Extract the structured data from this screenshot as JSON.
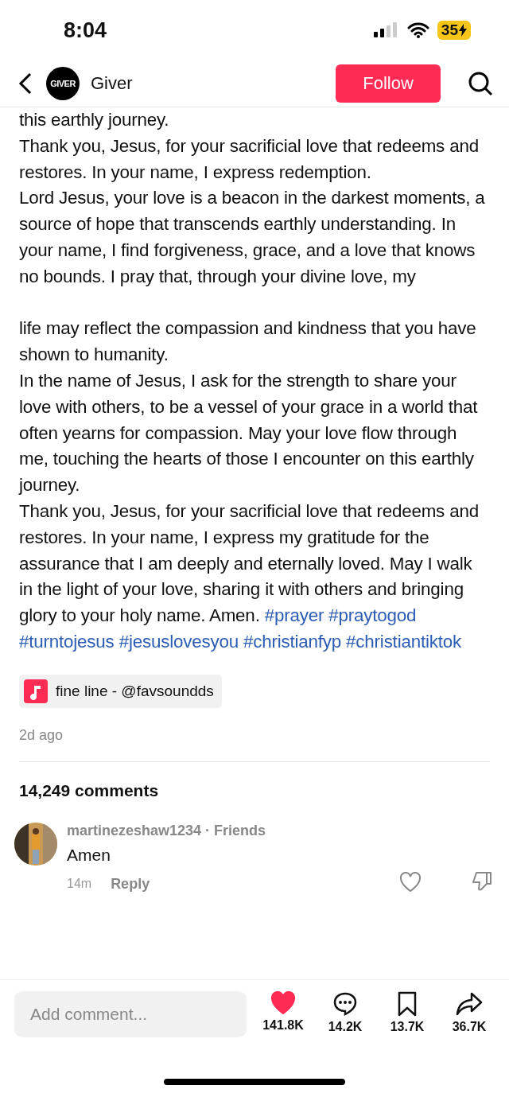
{
  "status_bar": {
    "time": "8:04",
    "battery": "35"
  },
  "header": {
    "account": "Giver",
    "avatar_text": "GIVER",
    "follow": "Follow"
  },
  "caption": {
    "paragraphs": [
      "this earthly journey.",
      "Thank you, Jesus, for your sacrificial love that redeems and restores. In your name, I express redemption.",
      "Lord Jesus, your love is a beacon in the darkest moments, a source of hope that transcends earthly understanding. In your name, I find forgiveness, grace, and a love that knows no bounds. I pray that, through your divine love, my",
      "life may reflect the compassion and kindness that you have shown to humanity.",
      "In the name of Jesus, I ask for the strength to share your love with others, to be a vessel of your grace in a world that often yearns for compassion. May your love flow through me, touching the hearts of those I encounter on this earthly journey."
    ],
    "last_paragraph": "Thank you, Jesus, for your sacrificial love that redeems and restores. In your name, I express my gratitude for the assurance that I am deeply and eternally loved. May I walk in the light of your love, sharing it with others and bringing glory to your holy name. Amen.",
    "hashtags": [
      "#prayer",
      "#praytogod",
      "#turntojesus",
      "#jesuslovesyou",
      "#christianfyp",
      "#christiantiktok"
    ]
  },
  "sound": "fine line - @favsoundds",
  "posted": "2d ago",
  "comments_count": "14,249 comments",
  "comments": [
    {
      "user": "martinezeshaw1234",
      "relation": "· Friends",
      "text": "Amen",
      "time": "14m",
      "reply": "Reply",
      "liked": false
    }
  ],
  "bottom_bar": {
    "placeholder": "Add comment...",
    "liked": true,
    "likes": "141.8K",
    "comments": "14.2K",
    "saves": "13.7K",
    "shares": "36.7K"
  }
}
